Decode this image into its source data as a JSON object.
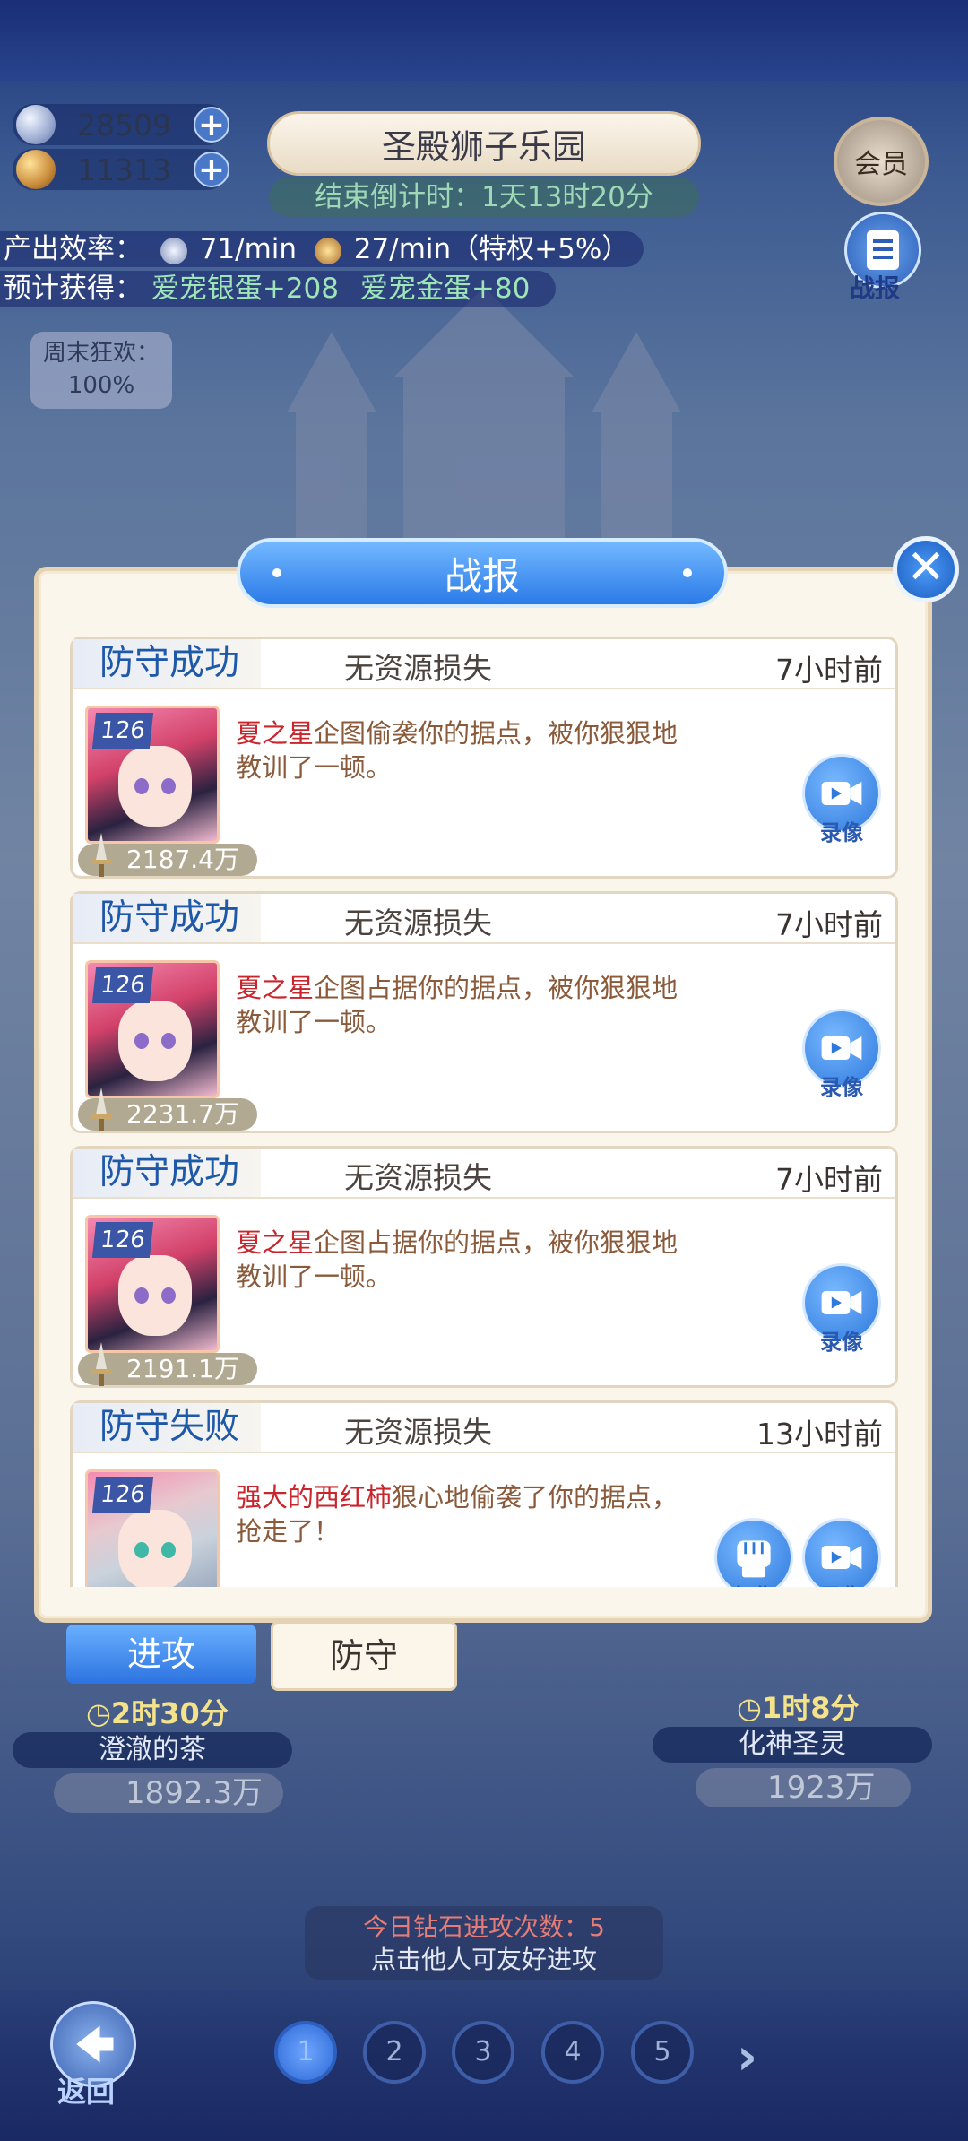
{
  "hud": {
    "silver_amount": "28509",
    "gold_amount": "11313",
    "stage_title": "圣殿狮子乐园",
    "countdown": "结束倒计时：1天13时20分",
    "vip_label": "会员",
    "report_label": "战报",
    "output_label": "产出效率：",
    "output_silver": "71/min",
    "output_gold": "27/min（特权+5%）",
    "expected_label": "预计获得：",
    "expected_silver": "爱宠银蛋+208",
    "expected_gold": "爱宠金蛋+80",
    "weekend_label": "周末狂欢：",
    "weekend_value": "100%"
  },
  "dialog": {
    "title": "战报",
    "close_label": "✕",
    "reports": [
      {
        "result": "防守成功",
        "loss": "无资源损失",
        "time": "7小时前",
        "level": "126",
        "power": "2187.4万",
        "attacker": "夏之星",
        "message": "企图偷袭你的据点，被你狠狠地教训了一顿。",
        "replay_label": "录像"
      },
      {
        "result": "防守成功",
        "loss": "无资源损失",
        "time": "7小时前",
        "level": "126",
        "power": "2231.7万",
        "attacker": "夏之星",
        "message": "企图占据你的据点，被你狠狠地教训了一顿。",
        "replay_label": "录像"
      },
      {
        "result": "防守成功",
        "loss": "无资源损失",
        "time": "7小时前",
        "level": "126",
        "power": "2191.1万",
        "attacker": "夏之星",
        "message": "企图占据你的据点，被你狠狠地教训了一顿。",
        "replay_label": "录像"
      },
      {
        "result": "防守失败",
        "loss": "无资源损失",
        "time": "13小时前",
        "level": "126",
        "power": "",
        "attacker": "强大的西红柿",
        "message": "狠心地偷袭了你的据点，抢走了！",
        "revenge_label": "复仇",
        "replay_label": "录像"
      }
    ]
  },
  "tabs": {
    "attack": "进攻",
    "defend": "防守"
  },
  "players": {
    "left": {
      "timer": "2时30分",
      "name": "澄澈的茶",
      "power": "1892.3万"
    },
    "right": {
      "timer": "1时8分",
      "name": "化神圣灵",
      "power": "1923万"
    }
  },
  "notice": {
    "line1": "今日钻石进攻次数：5",
    "line2": "点击他人可友好进攻"
  },
  "pager": {
    "pages": [
      "1",
      "2",
      "3",
      "4",
      "5"
    ],
    "current": "1",
    "next": "›",
    "back_label": "返回"
  },
  "colors": {
    "accent_blue": "#2b7be8",
    "attacker_red": "#c8252c",
    "result_blue": "#1e58a8"
  }
}
